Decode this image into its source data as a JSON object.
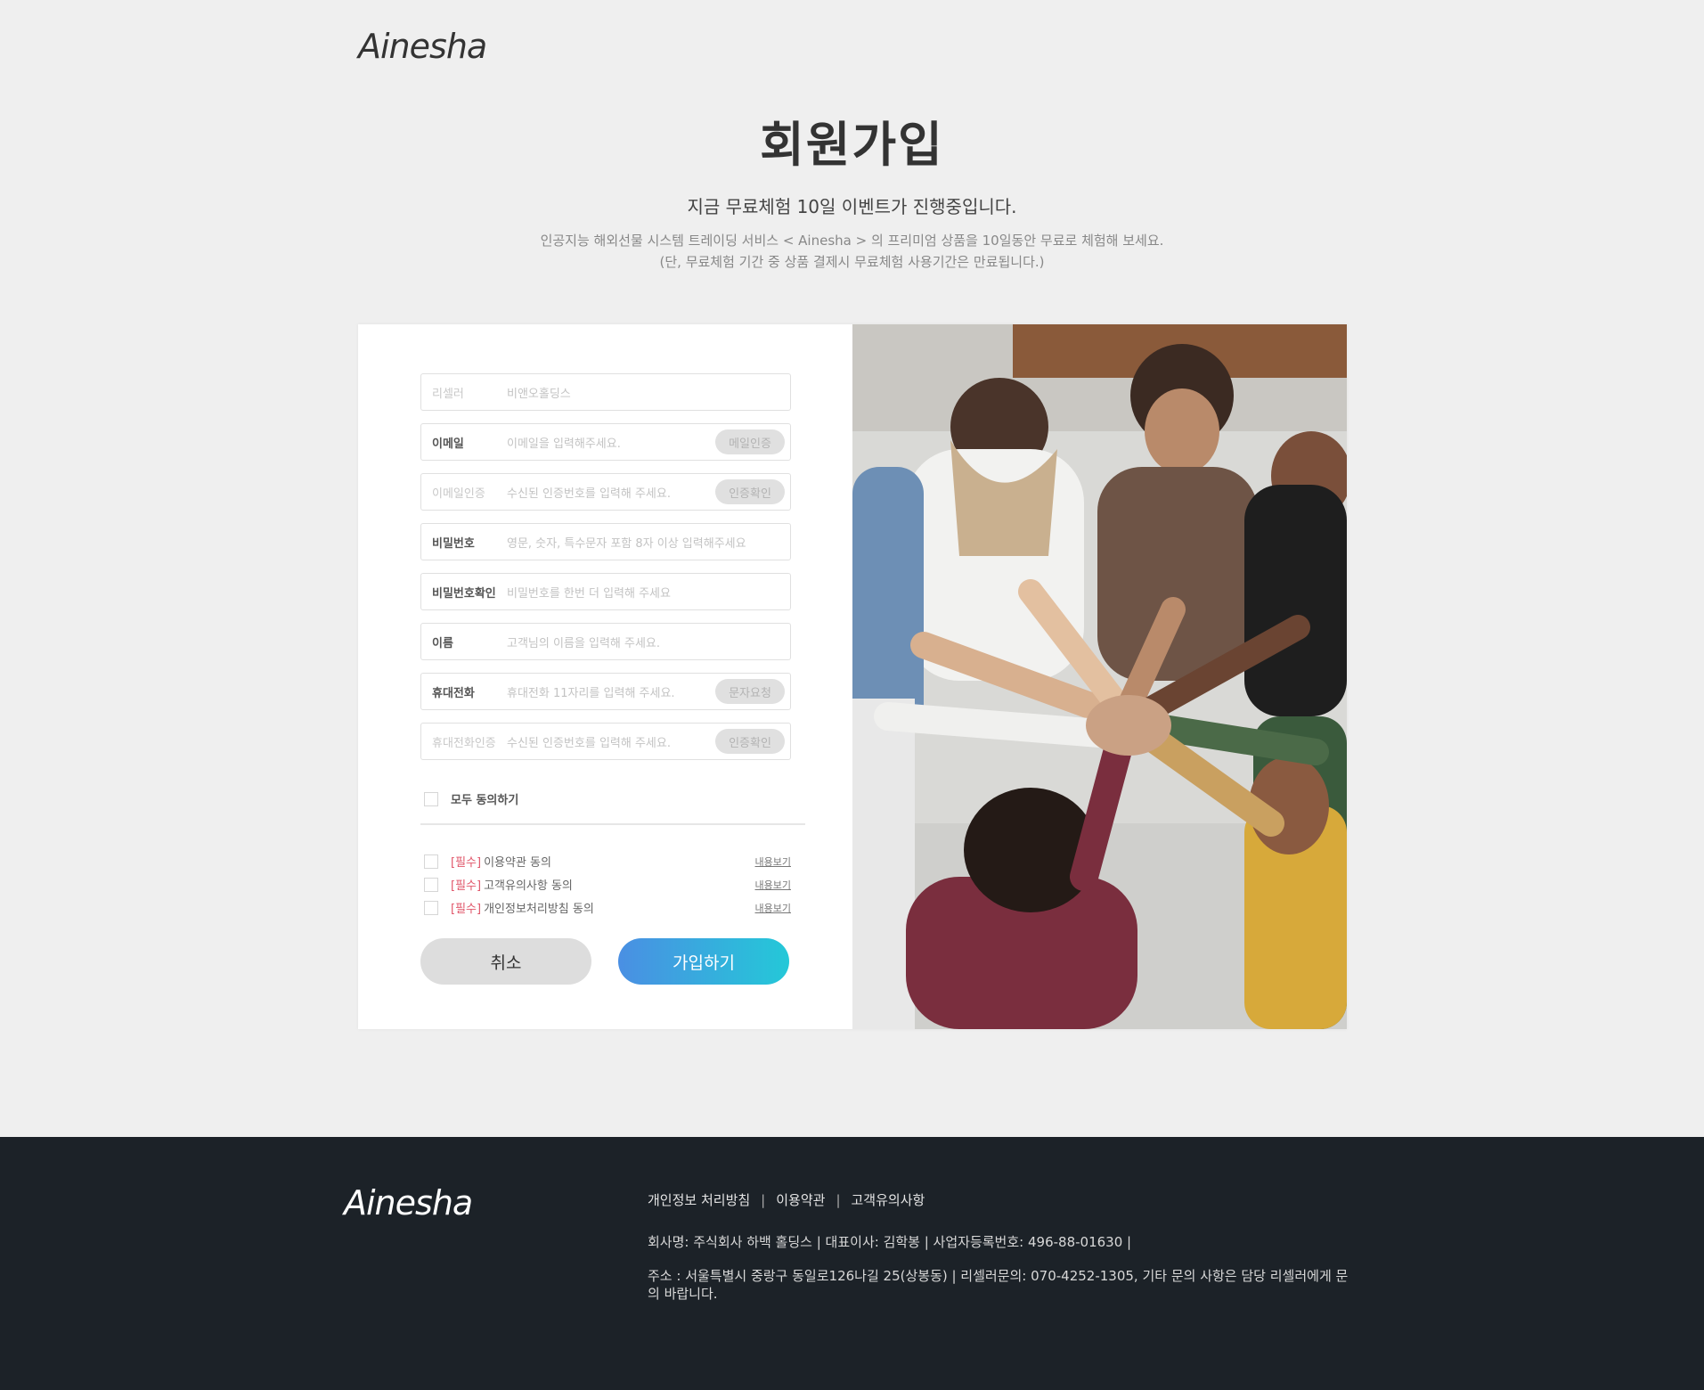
{
  "brand": {
    "logo": "Ainesha"
  },
  "header": {
    "title": "회원가입",
    "lead": "지금 무료체험 10일 이벤트가 진행중입니다.",
    "desc_line1": "인공지능 해외선물 시스템 트레이딩 서비스 < Ainesha > 의 프리미엄 상품을 10일동안 무료로 체험해 보세요.",
    "desc_line2": "(단, 무료체험 기간 중 상품 결제시 무료체험 사용기간은 만료됩니다.)"
  },
  "form": {
    "fields": [
      {
        "label": "리셀러",
        "value": "비앤오홀딩스"
      },
      {
        "label": "이메일",
        "placeholder": "이메일을 입력해주세요.",
        "button": "메일인증"
      },
      {
        "label": "이메일인증",
        "placeholder": "수신된 인증번호를 입력해 주세요.",
        "button": "인증확인"
      },
      {
        "label": "비밀번호",
        "placeholder": "영문, 숫자, 특수문자 포함 8자 이상 입력해주세요"
      },
      {
        "label": "비밀번호확인",
        "placeholder": "비밀번호를 한번 더 입력해 주세요"
      },
      {
        "label": "이름",
        "placeholder": "고객님의 이름을 입력해 주세요."
      },
      {
        "label": "휴대전화",
        "placeholder": "휴대전화 11자리를 입력해 주세요.",
        "button": "문자요청"
      },
      {
        "label": "휴대전화인증",
        "placeholder": "수신된 인증번호를 입력해 주세요.",
        "button": "인증확인"
      }
    ],
    "agree_all": "모두 동의하기",
    "agreements": [
      {
        "required": "[필수]",
        "text": "이용약관 동의",
        "more": "내용보기"
      },
      {
        "required": "[필수]",
        "text": "고객유의사항 동의",
        "more": "내용보기"
      },
      {
        "required": "[필수]",
        "text": "개인정보처리방침 동의",
        "more": "내용보기"
      }
    ],
    "cancel": "취소",
    "submit": "가입하기"
  },
  "footer": {
    "logo": "Ainesha",
    "links": [
      "개인정보 처리방침",
      "이용약관",
      "고객유의사항"
    ],
    "company": "회사명: 주식회사 하백 홀딩스 | 대표이사: 김학봉 | 사업자등록번호: 496-88-01630 |",
    "address": "주소 : 서울특별시 중랑구 동일로126나길 25(상봉동) | 리셀러문의: 070-4252-1305, 기타 문의 사항은 담당 리셀러에게 문의 바랍니다."
  },
  "colors": {
    "accent_start": "#4a8fe3",
    "accent_end": "#24c8d8",
    "required": "#e0566a",
    "footer_bg": "#1c2228"
  },
  "icons": {
    "agree_checkbox": "checkbox-icon"
  }
}
